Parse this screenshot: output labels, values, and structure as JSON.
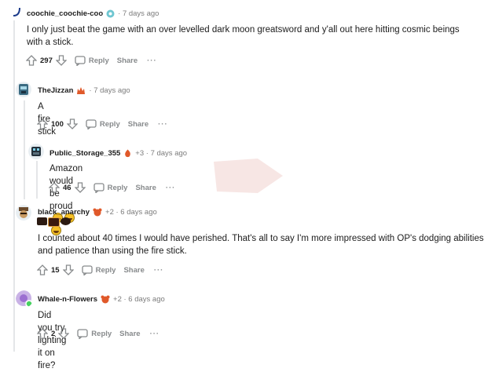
{
  "comments": [
    {
      "username": "coochie_coochie-coo",
      "meta": "· 7 days ago",
      "body": "I only just beat the game with an over levelled dark moon greatsword and y'all out here hitting cosmic beings with a stick.",
      "votes": "297",
      "reply": "Reply",
      "share": "Share"
    },
    {
      "username": "TheJizzan",
      "meta": "· 7 days ago",
      "body": "A fire stick",
      "votes": "100",
      "reply": "Reply",
      "share": "Share"
    },
    {
      "username": "Public_Storage_355",
      "meta": "+3 · 7 days ago",
      "body": "Amazon would be proud",
      "votes": "46",
      "reply": "Reply",
      "share": "Share"
    },
    {
      "username": "black_anarchy",
      "meta": "+2 · 6 days ago",
      "body": "I counted about 40 times I would have perished. That's all to say I'm more impressed with OP's dodging abilities and patience than using the fire stick.",
      "votes": "15",
      "reply": "Reply",
      "share": "Share"
    },
    {
      "username": "Whale-n-Flowers",
      "meta": "+2 · 6 days ago",
      "body": "Did you try lighting it on fire?",
      "votes": "2",
      "reply": "Reply",
      "share": "Share"
    }
  ],
  "more_label": "···",
  "colors": {
    "meta": "#7c7c7c",
    "action": "#878a8c",
    "thread_line": "#e4e6e8"
  }
}
